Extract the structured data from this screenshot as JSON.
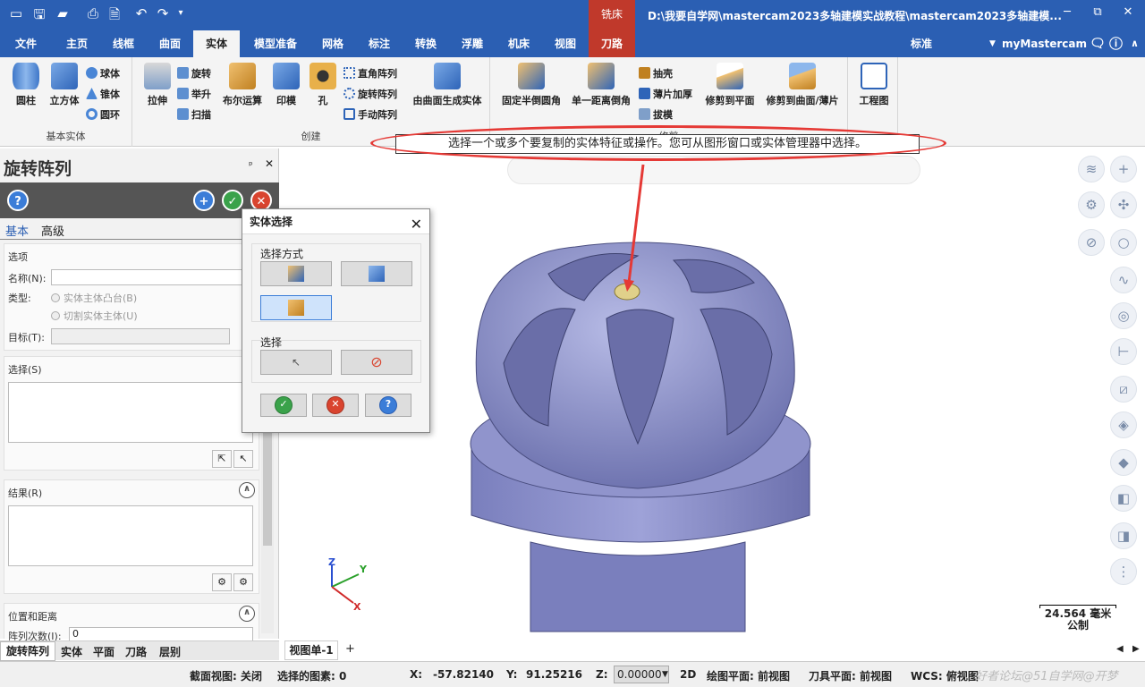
{
  "titlebar": {
    "context_tab": "铣床",
    "window_title": "D:\\我要自学网\\mastercam2023多轴建模实战教程\\mastercam2023多轴建模...",
    "minimize": "─",
    "restore": "⧉",
    "close": "✕"
  },
  "menu": {
    "tabs": [
      "文件",
      "主页",
      "线框",
      "曲面",
      "实体",
      "模型准备",
      "网格",
      "标注",
      "转换",
      "浮雕",
      "机床",
      "视图",
      "刀路"
    ],
    "active": "实体",
    "right_standard": "标准",
    "right_account": "myMastercam"
  },
  "ribbon": {
    "basic": {
      "label": "基本实体",
      "cylinder": "圆柱",
      "cube": "立方体",
      "sphere": "球体",
      "cone": "锥体",
      "torus": "圆环"
    },
    "create": {
      "label": "创建",
      "extrude": "拉伸",
      "revolve": "旋转",
      "loft": "举升",
      "sweep": "扫描",
      "boolean": "布尔运算",
      "imprint": "印模",
      "hole": "孔",
      "rect_pattern": "直角阵列",
      "rot_pattern": "旋转阵列",
      "manual_pattern": "手动阵列",
      "from_surface": "由曲面生成实体"
    },
    "finish": {
      "label": "修剪",
      "fillet": "固定半倒圆角",
      "chamfer": "单一距离倒角",
      "shell": "抽壳",
      "thicken": "薄片加厚",
      "draft": "拔模",
      "trim_plane": "修剪到平面",
      "trim_surface": "修剪到曲面/薄片"
    },
    "drawing": {
      "drawing": "工程图"
    }
  },
  "annotation": "选择一个或多个要复制的实体特征或操作。您可从图形窗口或实体管理器中选择。",
  "left_panel": {
    "title": "旋转阵列",
    "pin": "ᵖ",
    "close": "✕",
    "help": "?",
    "tabs": [
      "基本",
      "高级"
    ],
    "options_label": "选项",
    "name_label": "名称(N):",
    "type_label": "类型:",
    "type_opt1": "实体主体凸台(B)",
    "type_opt2": "切割实体主体(U)",
    "target_label": "目标(T):",
    "select_label": "选择(S)",
    "result_label": "结果(R)",
    "pos_label": "位置和距离",
    "count_label": "阵列次数(I):",
    "count_value": "0"
  },
  "bottom_tabs": [
    "旋转阵列",
    "实体",
    "平面",
    "刀路",
    "层别"
  ],
  "view_tab": "视图单-1",
  "dialog": {
    "title": "实体选择",
    "method_label": "选择方式",
    "select_label": "选择"
  },
  "scale": {
    "value": "24.564 毫米",
    "unit": "公制"
  },
  "axis": {
    "z": "Z",
    "y": "Y",
    "x": "X"
  },
  "status": {
    "section_view": "截面视图: 关闭",
    "selected": "选择的图素: 0",
    "x_label": "X:",
    "x_value": "-57.82140",
    "y_label": "Y:",
    "y_value": "91.25216",
    "z_label": "Z:",
    "z_value": "0.00000",
    "mode": "2D",
    "draw_plane": "绘图平面: 前视图",
    "tool_plane": "刀具平面: 前视图",
    "wcs": "WCS: 俯视图"
  },
  "watermark": "好者论坛@51自学网@开梦",
  "colors": {
    "titlebar": "#2b5fb3",
    "context": "#c0392b",
    "model": "#8a8fc6",
    "annotation_ring": "#e53935"
  }
}
